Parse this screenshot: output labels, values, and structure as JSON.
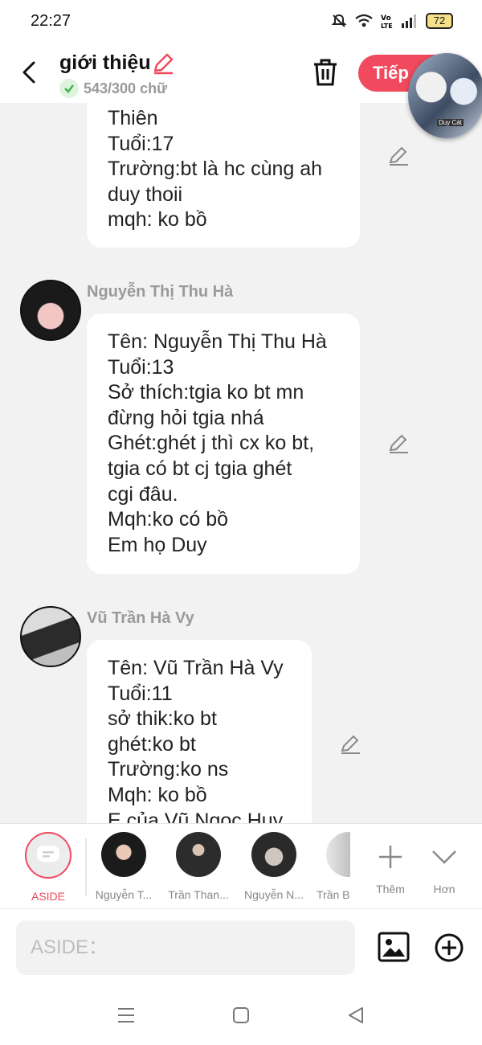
{
  "status_bar": {
    "time": "22:27",
    "battery": "72"
  },
  "header": {
    "title": "giới thiệu",
    "word_count": "543/300 chữ",
    "next_label": "Tiếp",
    "float_tag": "Duy Cát"
  },
  "messages": [
    {
      "author": "",
      "lines": [
        "Thiên",
        "Tuổi:17",
        "Trường:bt là hc cùng ah",
        "duy thoii",
        "mqh: ko bồ"
      ]
    },
    {
      "author": "Nguyễn Thị Thu Hà",
      "lines": [
        "Tên: Nguyễn Thị Thu Hà",
        "Tuổi:13",
        "Sở thích:tgia ko bt mn",
        "đừng hỏi tgia nhá",
        "Ghét:ghét j thì cx ko bt,",
        "tgia có bt cj tgia ghét",
        "cgi đâu.",
        "Mqh:ko có bồ",
        "Em họ Duy"
      ]
    },
    {
      "author": "Vũ Trần Hà Vy",
      "lines": [
        "Tên: Vũ Trần Hà Vy",
        "Tuổi:11",
        "sở thik:ko bt",
        "ghét:ko bt",
        "Trường:ko ns",
        "Mqh: ko bồ",
        "E của Vũ Ngọc Huy"
      ]
    }
  ],
  "character_bar": {
    "aside": "ASIDE",
    "chars": [
      "Nguyễn T...",
      "Trần Than...",
      "Nguyễn N...",
      "Trần B"
    ],
    "more_label": "Thêm",
    "expand_label": "Hơn"
  },
  "input": {
    "placeholder": "ASIDE："
  },
  "colors": {
    "accent": "#f1495d",
    "background": "#f2f2f2"
  }
}
